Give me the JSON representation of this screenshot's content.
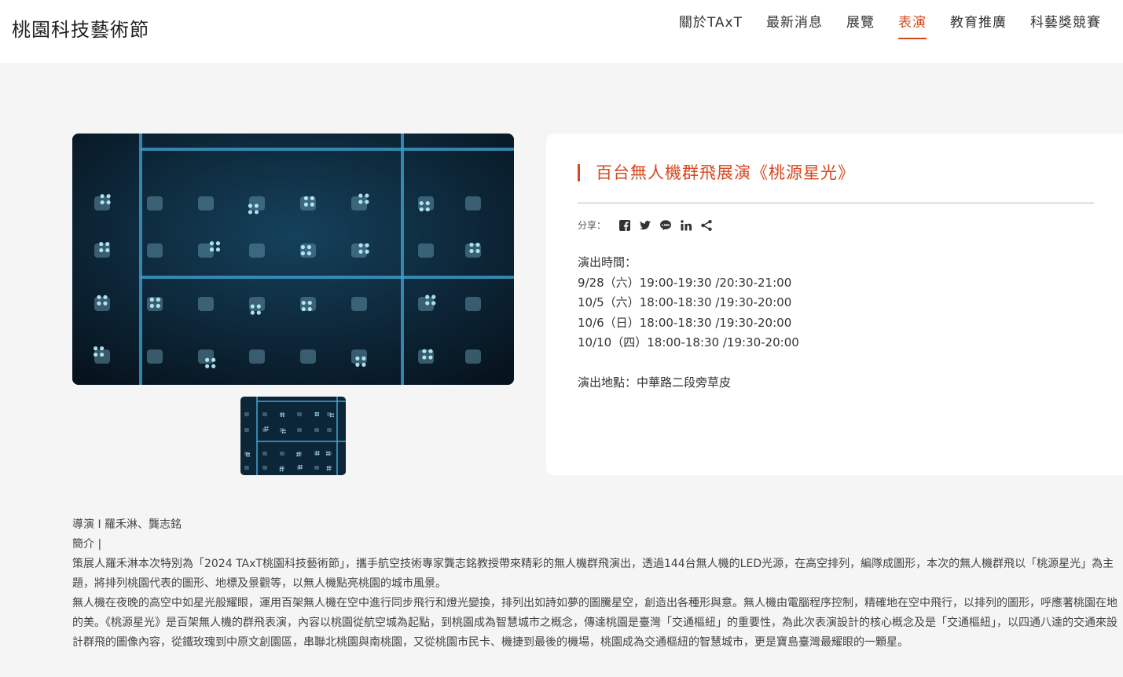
{
  "site": {
    "title": "桃園科技藝術節"
  },
  "nav": {
    "items": [
      {
        "label": "關於TAxT",
        "active": false
      },
      {
        "label": "最新消息",
        "active": false
      },
      {
        "label": "展覽",
        "active": false
      },
      {
        "label": "表演",
        "active": true
      },
      {
        "label": "教育推廣",
        "active": false
      },
      {
        "label": "科藝獎競賽",
        "active": false
      }
    ]
  },
  "performance": {
    "title": "百台無人機群飛展演《桃源星光》",
    "share_label": "分享：",
    "share_icons": [
      "facebook-icon",
      "twitter-icon",
      "line-icon",
      "linkedin-icon",
      "share-icon"
    ],
    "showtimes_label": "演出時間：",
    "showtimes": [
      "9/28（六）19:00-19:30 /20:30-21:00",
      "10/5（六）18:00-18:30 /19:30-20:00",
      "10/6（日）18:00-18:30 /19:30-20:00",
      "10/10（四）18:00-18:30 /19:30-20:00"
    ],
    "venue": "演出地點：中華路二段旁草皮"
  },
  "credits": {
    "director": "導演 I 羅禾淋、龔志銘",
    "intro_label": "簡介 |",
    "paragraph1": "策展人羅禾淋本次特別為「2024 TAxT桃園科技藝術節」，攜手航空技術專家龔志銘教授帶來精彩的無人機群飛演出，透過144台無人機的LED光源，在高空排列，編隊成圖形，本次的無人機群飛以「桃源星光」為主題，將排列桃園代表的圖形、地標及景觀等，以無人機點亮桃園的城市風景。",
    "paragraph2": "無人機在夜晚的高空中如星光般耀眼，運用百架無人機在空中進行同步飛行和燈光變換，排列出如詩如夢的圖騰星空，創造出各種形與意。無人機由電腦程序控制，精確地在空中飛行，以排列的圖形，呼應著桃園在地的美。《桃源星光》是百架無人機的群飛表演，內容以桃園從航空城為起點，到桃園成為智慧城市之概念，傳達桃園是臺灣「交通樞紐」的重要性，為此次表演設計的核心概念及是「交通樞紐」，以四通八達的交通來設計群飛的圖像內容，從鐵玫瑰到中原文創園區，串聯北桃園與南桃園，又從桃園市民卡、機捷到最後的機場，桃園成為交通樞紐的智慧城市，更是寶島臺灣最耀眼的一顆星。"
  },
  "colors": {
    "accent": "#d9471e",
    "background": "#f5f5f5",
    "card": "#ffffff"
  }
}
